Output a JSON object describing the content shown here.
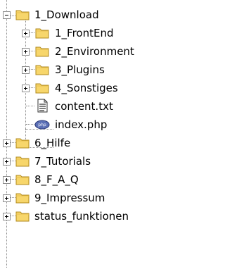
{
  "tree": {
    "root": {
      "label": "1_Download",
      "state": "expanded",
      "icon": "folder-icon"
    },
    "children": [
      {
        "label": "1_FrontEnd",
        "state": "collapsed",
        "icon": "folder-icon"
      },
      {
        "label": "2_Environment",
        "state": "collapsed",
        "icon": "folder-icon"
      },
      {
        "label": "3_Plugins",
        "state": "collapsed",
        "icon": "folder-icon"
      },
      {
        "label": "4_Sonstiges",
        "state": "collapsed",
        "icon": "folder-icon"
      },
      {
        "label": "content.txt",
        "state": "leaf",
        "icon": "text-file-icon"
      },
      {
        "label": "index.php",
        "state": "leaf",
        "icon": "php-file-icon"
      }
    ],
    "siblings": [
      {
        "label": "6_Hilfe",
        "state": "collapsed",
        "icon": "folder-icon"
      },
      {
        "label": "7_Tutorials",
        "state": "collapsed",
        "icon": "folder-icon"
      },
      {
        "label": "8_F_A_Q",
        "state": "collapsed",
        "icon": "folder-icon"
      },
      {
        "label": "9_Impressum",
        "state": "collapsed",
        "icon": "folder-icon"
      },
      {
        "label": "status_funktionen",
        "state": "collapsed",
        "icon": "folder-icon"
      }
    ]
  },
  "colors": {
    "folder_fill": "#f7d66b",
    "folder_tab": "#e8c04f",
    "folder_outline": "#b08a1e",
    "tree_lines": "#8c8c8c"
  }
}
